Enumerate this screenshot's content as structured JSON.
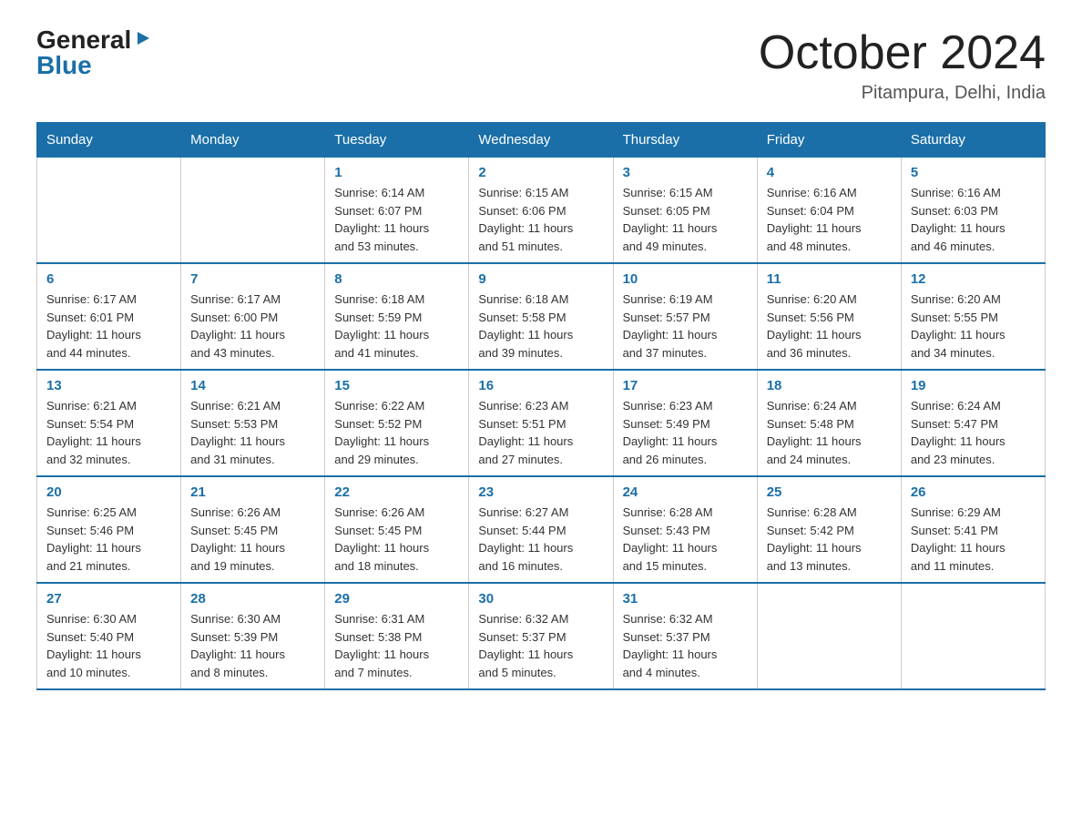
{
  "header": {
    "logo_general": "General",
    "logo_blue": "Blue",
    "title": "October 2024",
    "location": "Pitampura, Delhi, India"
  },
  "days_of_week": [
    "Sunday",
    "Monday",
    "Tuesday",
    "Wednesday",
    "Thursday",
    "Friday",
    "Saturday"
  ],
  "weeks": [
    [
      {
        "day": "",
        "info": ""
      },
      {
        "day": "",
        "info": ""
      },
      {
        "day": "1",
        "info": "Sunrise: 6:14 AM\nSunset: 6:07 PM\nDaylight: 11 hours\nand 53 minutes."
      },
      {
        "day": "2",
        "info": "Sunrise: 6:15 AM\nSunset: 6:06 PM\nDaylight: 11 hours\nand 51 minutes."
      },
      {
        "day": "3",
        "info": "Sunrise: 6:15 AM\nSunset: 6:05 PM\nDaylight: 11 hours\nand 49 minutes."
      },
      {
        "day": "4",
        "info": "Sunrise: 6:16 AM\nSunset: 6:04 PM\nDaylight: 11 hours\nand 48 minutes."
      },
      {
        "day": "5",
        "info": "Sunrise: 6:16 AM\nSunset: 6:03 PM\nDaylight: 11 hours\nand 46 minutes."
      }
    ],
    [
      {
        "day": "6",
        "info": "Sunrise: 6:17 AM\nSunset: 6:01 PM\nDaylight: 11 hours\nand 44 minutes."
      },
      {
        "day": "7",
        "info": "Sunrise: 6:17 AM\nSunset: 6:00 PM\nDaylight: 11 hours\nand 43 minutes."
      },
      {
        "day": "8",
        "info": "Sunrise: 6:18 AM\nSunset: 5:59 PM\nDaylight: 11 hours\nand 41 minutes."
      },
      {
        "day": "9",
        "info": "Sunrise: 6:18 AM\nSunset: 5:58 PM\nDaylight: 11 hours\nand 39 minutes."
      },
      {
        "day": "10",
        "info": "Sunrise: 6:19 AM\nSunset: 5:57 PM\nDaylight: 11 hours\nand 37 minutes."
      },
      {
        "day": "11",
        "info": "Sunrise: 6:20 AM\nSunset: 5:56 PM\nDaylight: 11 hours\nand 36 minutes."
      },
      {
        "day": "12",
        "info": "Sunrise: 6:20 AM\nSunset: 5:55 PM\nDaylight: 11 hours\nand 34 minutes."
      }
    ],
    [
      {
        "day": "13",
        "info": "Sunrise: 6:21 AM\nSunset: 5:54 PM\nDaylight: 11 hours\nand 32 minutes."
      },
      {
        "day": "14",
        "info": "Sunrise: 6:21 AM\nSunset: 5:53 PM\nDaylight: 11 hours\nand 31 minutes."
      },
      {
        "day": "15",
        "info": "Sunrise: 6:22 AM\nSunset: 5:52 PM\nDaylight: 11 hours\nand 29 minutes."
      },
      {
        "day": "16",
        "info": "Sunrise: 6:23 AM\nSunset: 5:51 PM\nDaylight: 11 hours\nand 27 minutes."
      },
      {
        "day": "17",
        "info": "Sunrise: 6:23 AM\nSunset: 5:49 PM\nDaylight: 11 hours\nand 26 minutes."
      },
      {
        "day": "18",
        "info": "Sunrise: 6:24 AM\nSunset: 5:48 PM\nDaylight: 11 hours\nand 24 minutes."
      },
      {
        "day": "19",
        "info": "Sunrise: 6:24 AM\nSunset: 5:47 PM\nDaylight: 11 hours\nand 23 minutes."
      }
    ],
    [
      {
        "day": "20",
        "info": "Sunrise: 6:25 AM\nSunset: 5:46 PM\nDaylight: 11 hours\nand 21 minutes."
      },
      {
        "day": "21",
        "info": "Sunrise: 6:26 AM\nSunset: 5:45 PM\nDaylight: 11 hours\nand 19 minutes."
      },
      {
        "day": "22",
        "info": "Sunrise: 6:26 AM\nSunset: 5:45 PM\nDaylight: 11 hours\nand 18 minutes."
      },
      {
        "day": "23",
        "info": "Sunrise: 6:27 AM\nSunset: 5:44 PM\nDaylight: 11 hours\nand 16 minutes."
      },
      {
        "day": "24",
        "info": "Sunrise: 6:28 AM\nSunset: 5:43 PM\nDaylight: 11 hours\nand 15 minutes."
      },
      {
        "day": "25",
        "info": "Sunrise: 6:28 AM\nSunset: 5:42 PM\nDaylight: 11 hours\nand 13 minutes."
      },
      {
        "day": "26",
        "info": "Sunrise: 6:29 AM\nSunset: 5:41 PM\nDaylight: 11 hours\nand 11 minutes."
      }
    ],
    [
      {
        "day": "27",
        "info": "Sunrise: 6:30 AM\nSunset: 5:40 PM\nDaylight: 11 hours\nand 10 minutes."
      },
      {
        "day": "28",
        "info": "Sunrise: 6:30 AM\nSunset: 5:39 PM\nDaylight: 11 hours\nand 8 minutes."
      },
      {
        "day": "29",
        "info": "Sunrise: 6:31 AM\nSunset: 5:38 PM\nDaylight: 11 hours\nand 7 minutes."
      },
      {
        "day": "30",
        "info": "Sunrise: 6:32 AM\nSunset: 5:37 PM\nDaylight: 11 hours\nand 5 minutes."
      },
      {
        "day": "31",
        "info": "Sunrise: 6:32 AM\nSunset: 5:37 PM\nDaylight: 11 hours\nand 4 minutes."
      },
      {
        "day": "",
        "info": ""
      },
      {
        "day": "",
        "info": ""
      }
    ]
  ]
}
